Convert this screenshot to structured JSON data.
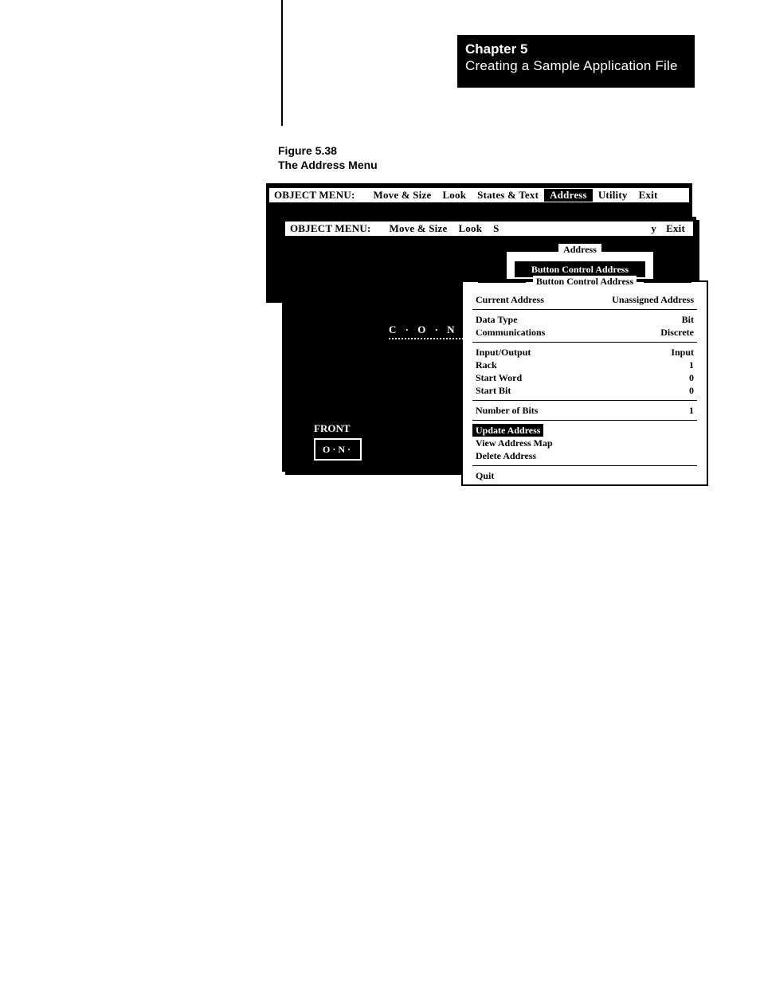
{
  "chapter": {
    "line1": "Chapter 5",
    "line2": "Creating a Sample Application File"
  },
  "figure": {
    "number": "Figure 5.38",
    "title": "The Address Menu"
  },
  "menubar_back": {
    "label": "OBJECT MENU:",
    "items": [
      "Move & Size",
      "Look",
      "States & Text",
      "Address",
      "Utility",
      "Exit"
    ],
    "selected_index": 3
  },
  "menubar_front": {
    "label": "OBJECT MENU:",
    "items_left": [
      "Move & Size",
      "Look",
      "S"
    ],
    "item_partial_right": "y",
    "item_exit": "Exit"
  },
  "address_dropdown": {
    "legend": "Address",
    "highlighted": "Button Control Address"
  },
  "panel": {
    "title": "Button Control Address",
    "current_address_label": "Current Address",
    "current_address_value": "Unassigned Address",
    "data_type_label": "Data Type",
    "data_type_value": "Bit",
    "communications_label": "Communications",
    "communications_value": "Discrete",
    "io_label": "Input/Output",
    "io_value": "Input",
    "rack_label": "Rack",
    "rack_value": "1",
    "start_word_label": "Start Word",
    "start_word_value": "0",
    "start_bit_label": "Start Bit",
    "start_bit_value": "0",
    "num_bits_label": "Number of Bits",
    "num_bits_value": "1",
    "update_address": "Update Address",
    "view_map": "View Address Map",
    "delete_address": "Delete Address",
    "quit": "Quit"
  },
  "canvas": {
    "conv": "C · O · N · V ·",
    "front": "FRONT",
    "on": "O·N·"
  }
}
